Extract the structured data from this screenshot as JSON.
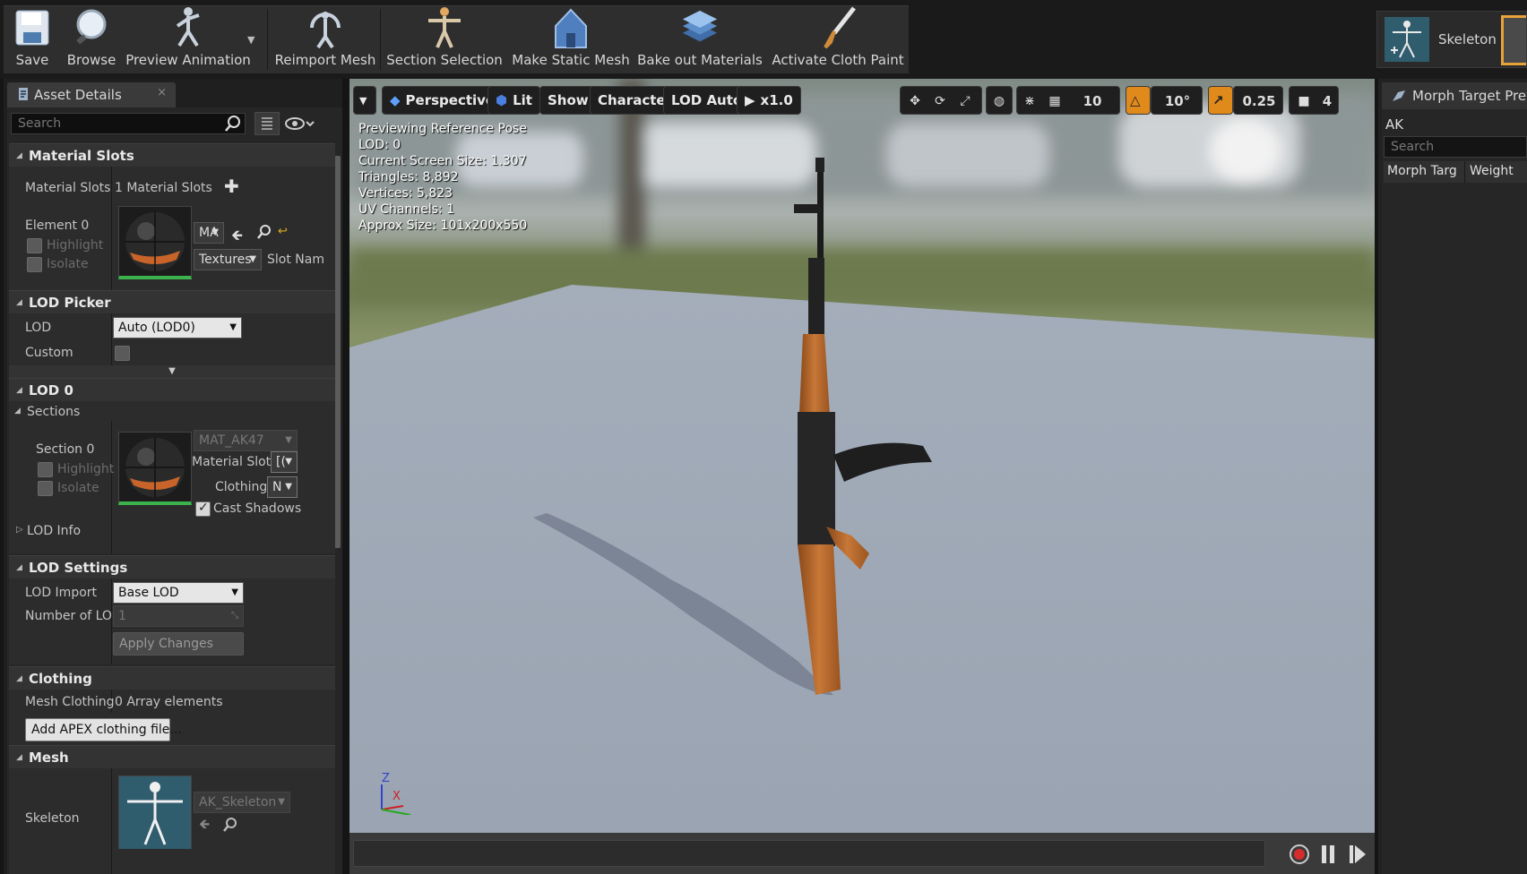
{
  "toolbar": {
    "save": "Save",
    "browse": "Browse",
    "preview_animation": "Preview Animation",
    "reimport_mesh": "Reimport Mesh",
    "section_selection": "Section Selection",
    "make_static_mesh": "Make Static Mesh",
    "bake_out_materials": "Bake out Materials",
    "activate_cloth_paint": "Activate Cloth Paint"
  },
  "editor_tab": {
    "label": "Skeleton"
  },
  "details": {
    "tab_label": "Asset Details",
    "search_placeholder": "Search",
    "material_slots": {
      "header": "Material Slots",
      "row_label": "Material Slots",
      "count_text": "1 Material Slots",
      "element_label": "Element 0",
      "highlight": "Highlight",
      "isolate": "Isolate",
      "material_combo": "MA",
      "textures_combo": "Textures",
      "slot_name_label": "Slot Nam"
    },
    "lod_picker": {
      "header": "LOD Picker",
      "lod_label": "LOD",
      "lod_value": "Auto (LOD0)",
      "custom_label": "Custom"
    },
    "lod0": {
      "header": "LOD 0",
      "sections_label": "Sections",
      "section_label": "Section 0",
      "highlight": "Highlight",
      "isolate": "Isolate",
      "material_name": "MAT_AK47",
      "material_slot_label": "Material Slot",
      "material_slot_value": "[(",
      "clothing_label": "Clothing",
      "clothing_value": "N",
      "cast_shadows_label": "Cast Shadows",
      "lod_info_label": "LOD Info"
    },
    "lod_settings": {
      "header": "LOD Settings",
      "lod_import_label": "LOD Import",
      "lod_import_value": "Base LOD",
      "number_of_lod_label": "Number of LOD",
      "number_of_lod_value": "1",
      "apply_changes": "Apply Changes"
    },
    "clothing": {
      "header": "Clothing",
      "mesh_clothing_label": "Mesh Clothing",
      "mesh_clothing_value": "0 Array elements",
      "add_apex_button": "Add APEX clothing file..."
    },
    "mesh": {
      "header": "Mesh",
      "skeleton_label": "Skeleton",
      "skeleton_value": "AK_Skeleton"
    }
  },
  "viewport": {
    "perspective": "Perspective",
    "lit": "Lit",
    "show": "Show",
    "character": "Character",
    "lod_auto": "LOD Auto",
    "speed": "x1.0",
    "grid_snap": "10",
    "rotation_snap": "10°",
    "scale_snap": "0.25",
    "camera_speed": "4",
    "stats": [
      "Previewing Reference Pose",
      "LOD: 0",
      "Current Screen Size: 1.307",
      "Triangles: 8,892",
      "Vertices: 5,823",
      "UV Channels: 1",
      "Approx Size: 101x200x550"
    ],
    "axis_z": "Z",
    "axis_x": "X"
  },
  "morph_panel": {
    "tab_label": "Morph Target Previ",
    "asset_name": "AK",
    "search_placeholder": "Search",
    "col_morph": "Morph Targ",
    "col_weight": "Weight"
  },
  "colors": {
    "accent_orange": "#e08a1c",
    "thumbnail_green": "#3bb24c"
  }
}
